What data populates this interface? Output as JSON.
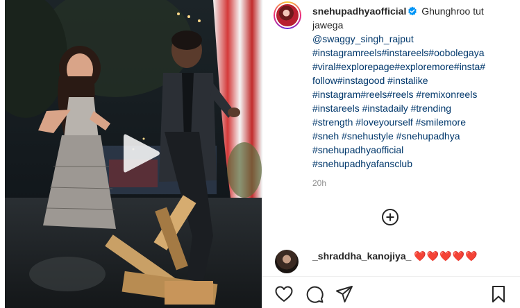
{
  "post": {
    "username": "snehupadhyaofficial",
    "caption_text": "Ghunghroo tut jawega",
    "mention": "@swaggy_singh_rajput",
    "hashtag_lines": [
      "#instagramreels#instareels#oobolegaya",
      "#viral#explorepage#exploremore#insta#",
      "follow#instagood #instalike",
      "#instagram#reels#reels #remixonreels",
      "#instareels #instadaily #trending",
      "#strength #loveyourself #smilemore",
      "#sneh #snehustyle #snehupadhya",
      "#snehupadhyaofficial",
      "#snehupadhyafansclub"
    ],
    "time_ago": "20h"
  },
  "comment": {
    "username": "_shraddha_kanojiya_",
    "text": "❤️❤️❤️❤️❤️"
  },
  "icons": {
    "play": "play-icon",
    "verified": "verified-badge-icon",
    "more": "add-circle-icon",
    "like": "heart-icon",
    "comment": "comment-icon",
    "share": "share-icon",
    "save": "bookmark-icon"
  },
  "colors": {
    "link": "#00376b",
    "verified": "#0095f6",
    "heart": "#ed1c24",
    "muted": "#8e8e8e"
  }
}
